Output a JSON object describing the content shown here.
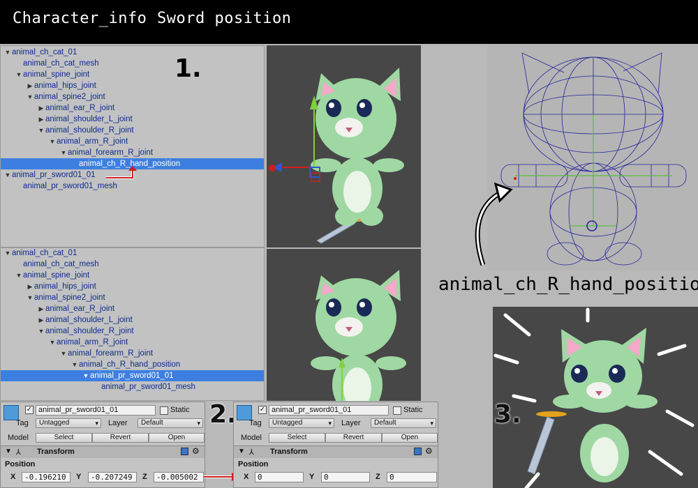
{
  "header": {
    "title_left": "Character_info",
    "title_right": "Sword position"
  },
  "tree_top": [
    {
      "label": "animal_ch_cat_01",
      "depth": 0,
      "arrow": "▼"
    },
    {
      "label": "animal_ch_cat_mesh",
      "depth": 1,
      "arrow": ""
    },
    {
      "label": "animal_spine_joint",
      "depth": 1,
      "arrow": "▼"
    },
    {
      "label": "animal_hips_joint",
      "depth": 2,
      "arrow": "▶"
    },
    {
      "label": "animal_spine2_joint",
      "depth": 2,
      "arrow": "▼"
    },
    {
      "label": "animal_ear_R_joint",
      "depth": 3,
      "arrow": "▶"
    },
    {
      "label": "animal_shoulder_L_joint",
      "depth": 3,
      "arrow": "▶"
    },
    {
      "label": "animal_shoulder_R_joint",
      "depth": 3,
      "arrow": "▼"
    },
    {
      "label": "animal_arm_R_joint",
      "depth": 4,
      "arrow": "▼"
    },
    {
      "label": "animal_forearm_R_joint",
      "depth": 5,
      "arrow": "▼"
    },
    {
      "label": "animal_ch_R_hand_position",
      "depth": 6,
      "arrow": "",
      "selected": true
    },
    {
      "label": "animal_pr_sword01_01",
      "depth": 0,
      "arrow": "▼"
    },
    {
      "label": "animal_pr_sword01_mesh",
      "depth": 1,
      "arrow": ""
    }
  ],
  "tree_bottom": [
    {
      "label": "animal_ch_cat_01",
      "depth": 0,
      "arrow": "▼"
    },
    {
      "label": "animal_ch_cat_mesh",
      "depth": 1,
      "arrow": ""
    },
    {
      "label": "animal_spine_joint",
      "depth": 1,
      "arrow": "▼"
    },
    {
      "label": "animal_hips_joint",
      "depth": 2,
      "arrow": "▶"
    },
    {
      "label": "animal_spine2_joint",
      "depth": 2,
      "arrow": "▼"
    },
    {
      "label": "animal_ear_R_joint",
      "depth": 3,
      "arrow": "▶"
    },
    {
      "label": "animal_shoulder_L_joint",
      "depth": 3,
      "arrow": "▶"
    },
    {
      "label": "animal_shoulder_R_joint",
      "depth": 3,
      "arrow": "▼"
    },
    {
      "label": "animal_arm_R_joint",
      "depth": 4,
      "arrow": "▼"
    },
    {
      "label": "animal_forearm_R_joint",
      "depth": 5,
      "arrow": "▼"
    },
    {
      "label": "animal_ch_R_hand_position",
      "depth": 6,
      "arrow": "▼"
    },
    {
      "label": "animal_pr_sword01_01",
      "depth": 7,
      "arrow": "▼",
      "selected": true
    },
    {
      "label": "animal_pr_sword01_mesh",
      "depth": 8,
      "arrow": ""
    }
  ],
  "steps": {
    "one": "1.",
    "two": "2.",
    "three": "3."
  },
  "caption": "animal_ch_R_hand_position",
  "inspector_before": {
    "object_name": "animal_pr_sword01_01",
    "static_label": "Static",
    "tag_label": "Tag",
    "tag_value": "Untagged",
    "layer_label": "Layer",
    "layer_value": "Default",
    "model_label": "Model",
    "select": "Select",
    "revert": "Revert",
    "open": "Open",
    "transform": "Transform",
    "position": "Position",
    "x_label": "X",
    "y_label": "Y",
    "z_label": "Z",
    "x": "-0.196210",
    "y": "-0.207249",
    "z": "-0.005002"
  },
  "inspector_after": {
    "object_name": "animal_pr_sword01_01",
    "static_label": "Static",
    "tag_label": "Tag",
    "tag_value": "Untagged",
    "layer_label": "Layer",
    "layer_value": "Default",
    "model_label": "Model",
    "select": "Select",
    "revert": "Revert",
    "open": "Open",
    "transform": "Transform",
    "position": "Position",
    "x_label": "X",
    "y_label": "Y",
    "z_label": "Z",
    "x": "0",
    "y": "0",
    "z": "0"
  },
  "colors": {
    "selection": "#3d7fe0",
    "tree_text": "#0c2a8c",
    "cat_body": "#9fd8a3",
    "arrow_red": "#d21d1d"
  }
}
